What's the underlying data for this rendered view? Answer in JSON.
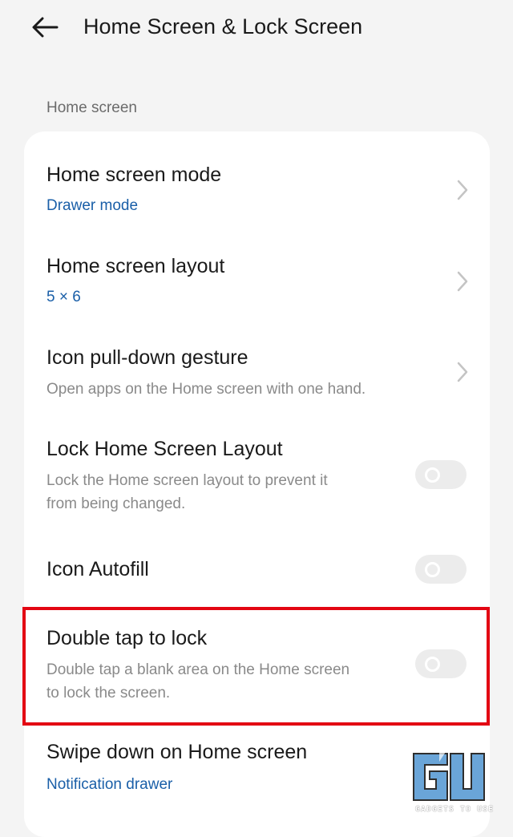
{
  "header": {
    "back_icon": "arrow-left-icon",
    "title": "Home Screen & Lock Screen"
  },
  "section": {
    "label": "Home screen"
  },
  "items": [
    {
      "title": "Home screen mode",
      "subtitle": "Drawer mode",
      "type": "link"
    },
    {
      "title": "Home screen layout",
      "subtitle": "5 × 6",
      "type": "link"
    },
    {
      "title": "Icon pull-down gesture",
      "subtitle": "Open apps on the Home screen with one hand.",
      "type": "link"
    },
    {
      "title": "Lock Home Screen Layout",
      "subtitle_line1": "Lock the Home screen layout to prevent it",
      "subtitle_line2": "from being changed.",
      "type": "toggle",
      "on": false
    },
    {
      "title": "Icon Autofill",
      "type": "toggle",
      "on": false
    },
    {
      "title": "Double tap to lock",
      "subtitle_line1": "Double tap a blank area on the Home screen",
      "subtitle_line2": "to lock the screen.",
      "type": "toggle",
      "on": false
    },
    {
      "title": "Swipe down on Home screen",
      "subtitle": "Notification drawer",
      "type": "link"
    }
  ],
  "watermark": {
    "text": "GADGETS TO USE"
  },
  "colors": {
    "background": "#f4f4f4",
    "card": "#ffffff",
    "accent_blue": "#1a5fa8",
    "highlight_red": "#e30613",
    "toggle_off": "#ececec"
  }
}
